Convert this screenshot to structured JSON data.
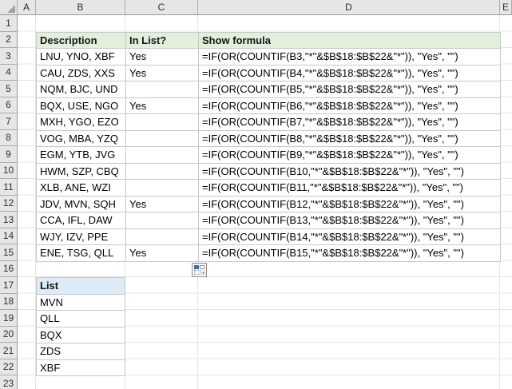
{
  "sheet": {
    "column_headers": [
      "A",
      "B",
      "C",
      "D",
      "E"
    ],
    "row_headers": [
      "1",
      "2",
      "3",
      "4",
      "5",
      "6",
      "7",
      "8",
      "9",
      "10",
      "11",
      "12",
      "13",
      "14",
      "15",
      "16",
      "17",
      "18",
      "19",
      "20",
      "21",
      "22",
      "23"
    ]
  },
  "colors": {
    "main_header_fill": "#E2EFDA",
    "list_header_fill": "#DDEBF7",
    "header_strip_fill": "#E6E6E6",
    "table_border": "#C7C7C7",
    "gridline": "#E3E5E7",
    "autofill_accent": "#2E75B6"
  },
  "main_table": {
    "headers": [
      "Description",
      "In List?",
      "Show formula"
    ],
    "rows": [
      {
        "description": "LNU, YNO, XBF",
        "in_list": "Yes",
        "formula": "=IF(OR(COUNTIF(B3,\"*\"&$B$18:$B$22&\"*\")), \"Yes\", \"\")"
      },
      {
        "description": "CAU, ZDS, XXS",
        "in_list": "Yes",
        "formula": "=IF(OR(COUNTIF(B4,\"*\"&$B$18:$B$22&\"*\")), \"Yes\", \"\")"
      },
      {
        "description": "NQM, BJC, UND",
        "in_list": "",
        "formula": "=IF(OR(COUNTIF(B5,\"*\"&$B$18:$B$22&\"*\")), \"Yes\", \"\")"
      },
      {
        "description": "BQX, USE, NGO",
        "in_list": "Yes",
        "formula": "=IF(OR(COUNTIF(B6,\"*\"&$B$18:$B$22&\"*\")), \"Yes\", \"\")"
      },
      {
        "description": "MXH, YGO, EZO",
        "in_list": "",
        "formula": "=IF(OR(COUNTIF(B7,\"*\"&$B$18:$B$22&\"*\")), \"Yes\", \"\")"
      },
      {
        "description": "VOG, MBA, YZQ",
        "in_list": "",
        "formula": "=IF(OR(COUNTIF(B8,\"*\"&$B$18:$B$22&\"*\")), \"Yes\", \"\")"
      },
      {
        "description": "EGM, YTB, JVG",
        "in_list": "",
        "formula": "=IF(OR(COUNTIF(B9,\"*\"&$B$18:$B$22&\"*\")), \"Yes\", \"\")"
      },
      {
        "description": "HWM, SZP, CBQ",
        "in_list": "",
        "formula": "=IF(OR(COUNTIF(B10,\"*\"&$B$18:$B$22&\"*\")), \"Yes\", \"\")"
      },
      {
        "description": "XLB, ANE, WZI",
        "in_list": "",
        "formula": "=IF(OR(COUNTIF(B11,\"*\"&$B$18:$B$22&\"*\")), \"Yes\", \"\")"
      },
      {
        "description": "JDV, MVN, SQH",
        "in_list": "Yes",
        "formula": "=IF(OR(COUNTIF(B12,\"*\"&$B$18:$B$22&\"*\")), \"Yes\", \"\")"
      },
      {
        "description": "CCA, IFL, DAW",
        "in_list": "",
        "formula": "=IF(OR(COUNTIF(B13,\"*\"&$B$18:$B$22&\"*\")), \"Yes\", \"\")"
      },
      {
        "description": "WJY, IZV, PPE",
        "in_list": "",
        "formula": "=IF(OR(COUNTIF(B14,\"*\"&$B$18:$B$22&\"*\")), \"Yes\", \"\")"
      },
      {
        "description": "ENE, TSG, QLL",
        "in_list": "Yes",
        "formula": "=IF(OR(COUNTIF(B15,\"*\"&$B$18:$B$22&\"*\")), \"Yes\", \"\")"
      }
    ]
  },
  "list_table": {
    "header": "List",
    "items": [
      "MVN",
      "QLL",
      "BQX",
      "ZDS",
      "XBF"
    ]
  }
}
